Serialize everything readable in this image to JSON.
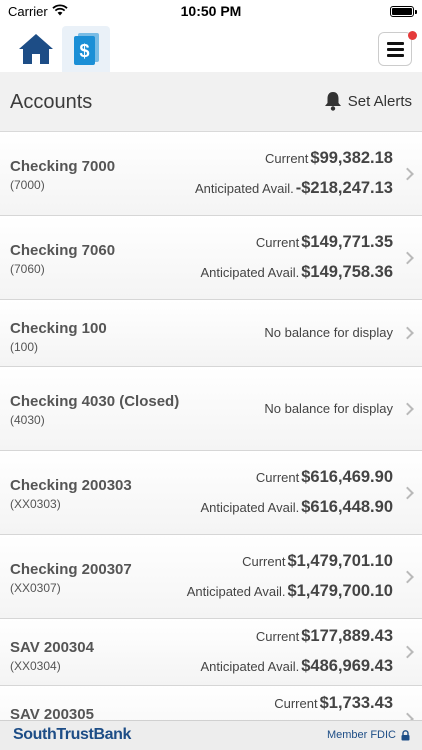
{
  "status_bar": {
    "carrier": "Carrier",
    "time": "10:50 PM"
  },
  "nav": {
    "home_icon": "home-icon",
    "accounts_icon": "dollar-document-icon",
    "menu_icon": "hamburger-menu-icon",
    "notification_color": "#e53a3a",
    "brand_color": "#1d4d86",
    "accent_color": "#1b8fd6"
  },
  "header": {
    "title": "Accounts",
    "set_alerts_label": "Set Alerts",
    "bell_icon": "bell-icon"
  },
  "accounts": [
    {
      "name": "Checking 7000",
      "number": "(7000)",
      "current_label": "Current",
      "current": "$99,382.18",
      "anticipated_label": "Anticipated Avail.",
      "anticipated": "-$218,247.13"
    },
    {
      "name": "Checking 7060",
      "number": "(7060)",
      "current_label": "Current",
      "current": "$149,771.35",
      "anticipated_label": "Anticipated Avail.",
      "anticipated": "$149,758.36"
    },
    {
      "name": "Checking 100",
      "number": "(100)",
      "no_balance": "No balance for display"
    },
    {
      "name": "Checking 4030 (Closed)",
      "number": "(4030)",
      "no_balance": "No balance for display"
    },
    {
      "name": "Checking 200303",
      "number": "(XX0303)",
      "current_label": "Current",
      "current": "$616,469.90",
      "anticipated_label": "Anticipated Avail.",
      "anticipated": "$616,448.90"
    },
    {
      "name": "Checking 200307",
      "number": "(XX0307)",
      "current_label": "Current",
      "current": "$1,479,701.10",
      "anticipated_label": "Anticipated Avail.",
      "anticipated": "$1,479,700.10"
    },
    {
      "name": "SAV 200304",
      "number": "(XX0304)",
      "current_label": "Current",
      "current": "$177,889.43",
      "anticipated_label": "Anticipated Avail.",
      "anticipated": "$486,969.43"
    },
    {
      "name": "SAV 200305",
      "number": "",
      "current_label": "Current",
      "current": "$1,733.43",
      "anticipated_label": "",
      "anticipated": ""
    }
  ],
  "footer": {
    "bank_name": "SouthTrustBank",
    "member_fdic": "Member FDIC",
    "lock_icon": "lock-icon"
  }
}
